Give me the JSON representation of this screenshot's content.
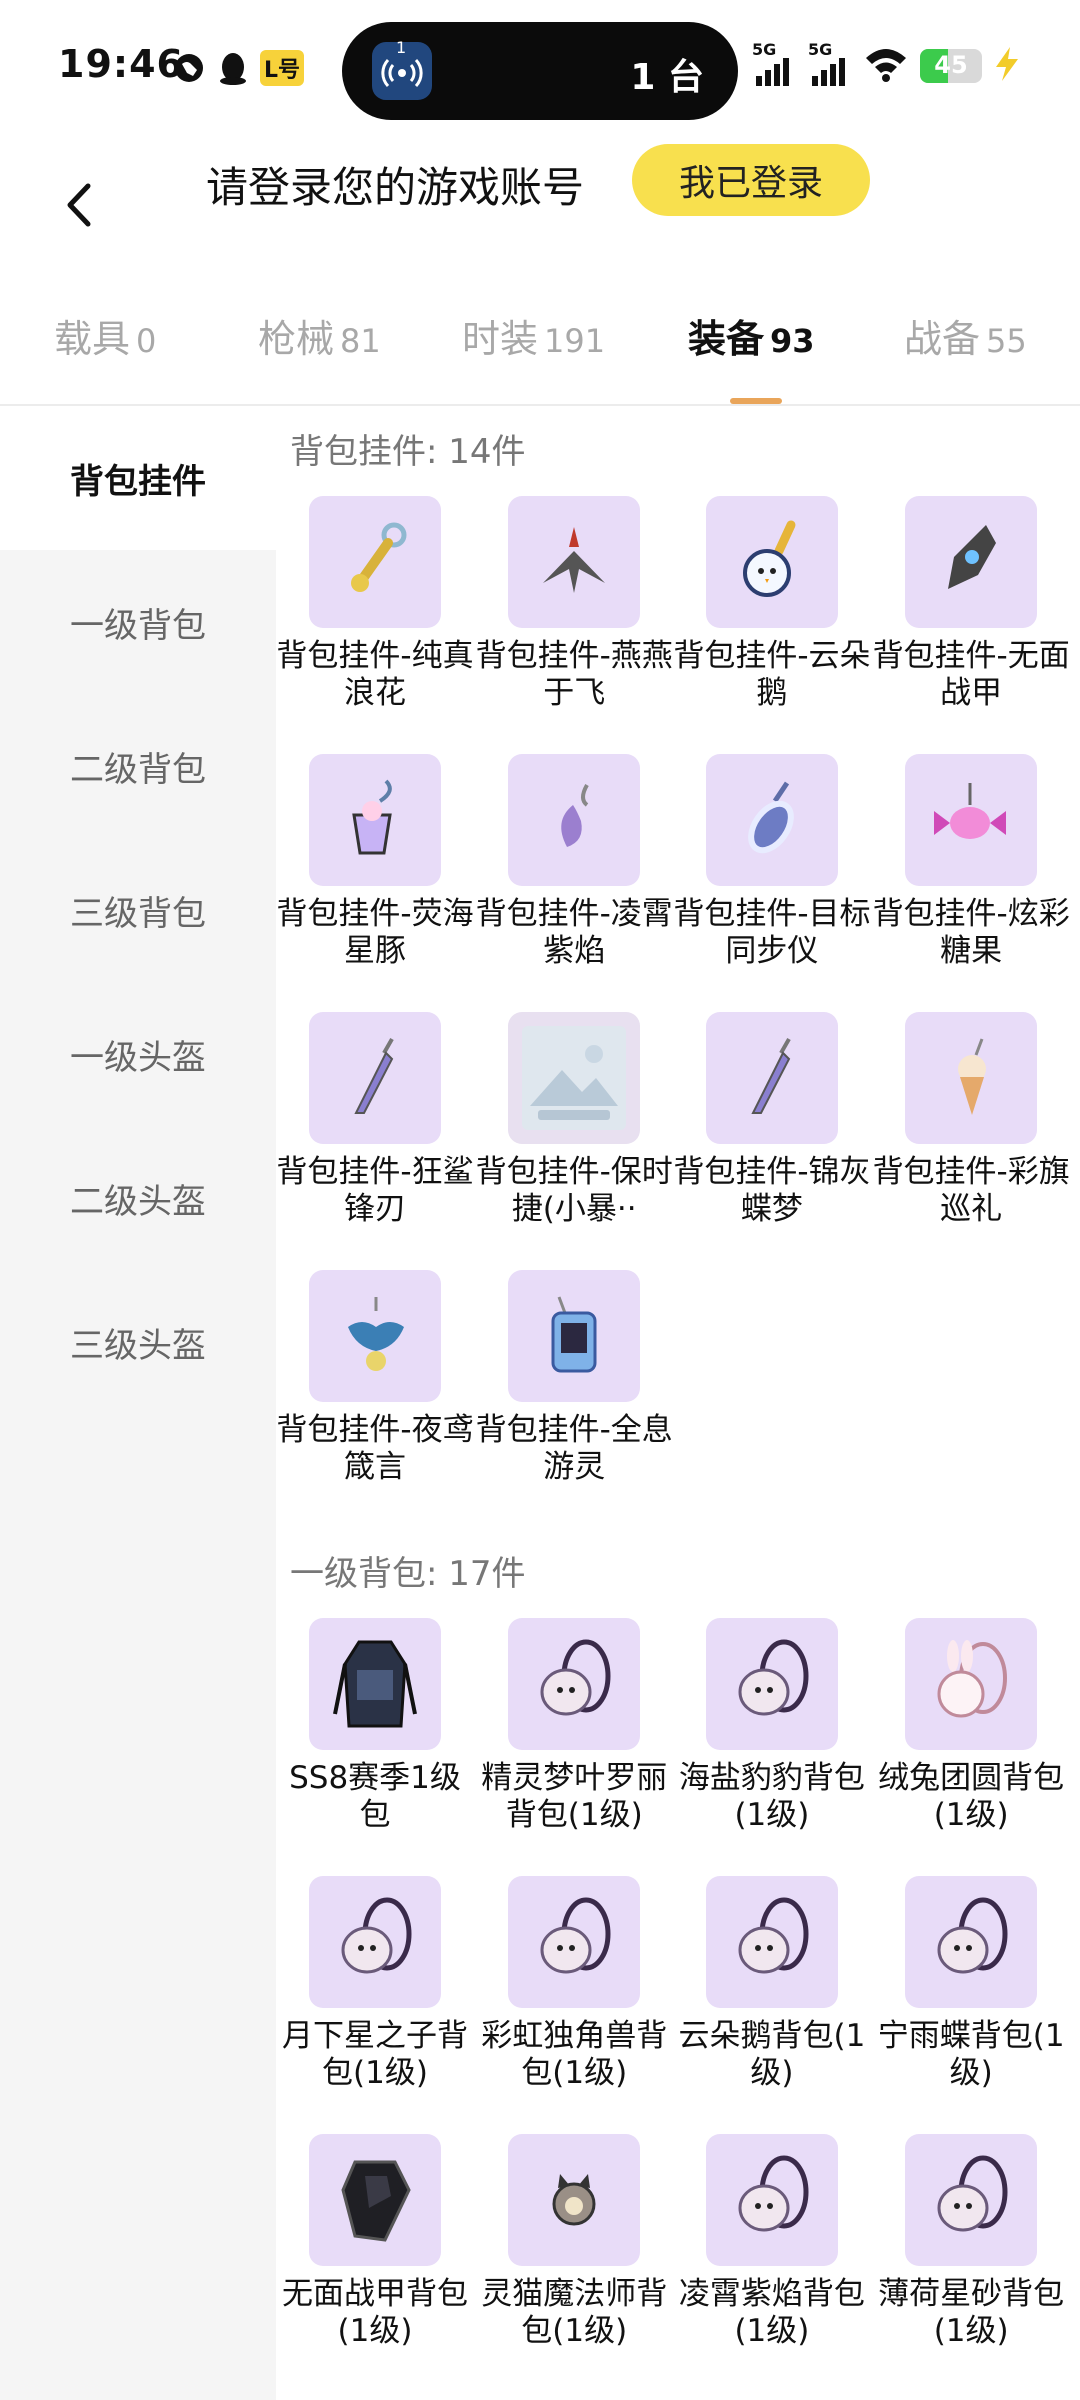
{
  "status_bar": {
    "time": "19:46",
    "carrier_badge": "L号",
    "island_text": "1 台",
    "island_app_number": "1",
    "signal_1_label": "5G",
    "signal_2_label": "5G",
    "battery": "45"
  },
  "header": {
    "title": "请登录您的游戏账号",
    "login_button": "我已登录"
  },
  "tabs": [
    {
      "label": "载具",
      "count": "0"
    },
    {
      "label": "枪械",
      "count": "81"
    },
    {
      "label": "时装",
      "count": "191"
    },
    {
      "label": "装备",
      "count": "93"
    },
    {
      "label": "战备",
      "count": "55"
    }
  ],
  "sidebar": {
    "items": [
      {
        "label": "背包挂件"
      },
      {
        "label": "一级背包"
      },
      {
        "label": "二级背包"
      },
      {
        "label": "三级背包"
      },
      {
        "label": "一级头盔"
      },
      {
        "label": "二级头盔"
      },
      {
        "label": "三级头盔"
      }
    ]
  },
  "sections": [
    {
      "title": "背包挂件: 14件",
      "items": [
        {
          "label": "背包挂件-纯真浪花",
          "icon": "keychain-icon"
        },
        {
          "label": "背包挂件-燕燕于飞",
          "icon": "bird-charm-icon"
        },
        {
          "label": "背包挂件-云朵鹅",
          "icon": "goose-charm-icon"
        },
        {
          "label": "背包挂件-无面战甲",
          "icon": "armor-charm-icon"
        },
        {
          "label": "背包挂件-荧海星豚",
          "icon": "drink-charm-icon"
        },
        {
          "label": "背包挂件-凌霄紫焰",
          "icon": "flame-charm-icon"
        },
        {
          "label": "背包挂件-目标同步仪",
          "icon": "ring-charm-icon"
        },
        {
          "label": "背包挂件-炫彩糖果",
          "icon": "candy-charm-icon"
        },
        {
          "label": "背包挂件-狂鲨锋刃",
          "icon": "blade-charm-icon"
        },
        {
          "label": "背包挂件-保时捷(小暴··",
          "icon": "image-placeholder-icon"
        },
        {
          "label": "背包挂件-锦灰蝶梦",
          "icon": "blade-charm-icon"
        },
        {
          "label": "背包挂件-彩旗巡礼",
          "icon": "icecream-charm-icon"
        },
        {
          "label": "背包挂件-夜鸢箴言",
          "icon": "gem-charm-icon"
        },
        {
          "label": "背包挂件-全息游灵",
          "icon": "device-charm-icon"
        }
      ]
    },
    {
      "title": "一级背包: 17件",
      "items": [
        {
          "label": "SS8赛季1级包",
          "icon": "backpack-icon"
        },
        {
          "label": "精灵梦叶罗丽背包(1级)",
          "icon": "pouch-bag-icon"
        },
        {
          "label": "海盐豹豹背包(1级)",
          "icon": "pouch-bag-icon"
        },
        {
          "label": "绒兔团圆背包(1级)",
          "icon": "bunny-bag-icon"
        },
        {
          "label": "月下星之子背包(1级)",
          "icon": "pouch-bag-icon"
        },
        {
          "label": "彩虹独角兽背包(1级)",
          "icon": "pouch-bag-icon"
        },
        {
          "label": "云朵鹅背包(1级)",
          "icon": "pouch-bag-icon"
        },
        {
          "label": "宁雨蝶背包(1级)",
          "icon": "pouch-bag-icon"
        },
        {
          "label": "无面战甲背包(1级)",
          "icon": "armor-bag-icon"
        },
        {
          "label": "灵猫魔法师背包(1级)",
          "icon": "cat-bag-icon"
        },
        {
          "label": "凌霄紫焰背包(1级)",
          "icon": "pouch-bag-icon"
        },
        {
          "label": "薄荷星砂背包(1级)",
          "icon": "pouch-bag-icon"
        }
      ]
    }
  ],
  "colors": {
    "accent_yellow": "#f8e04e",
    "tab_underline": "#e9a55a",
    "thumb_bg": "#e8dcf8",
    "sidebar_bg": "#f5f5f5"
  }
}
